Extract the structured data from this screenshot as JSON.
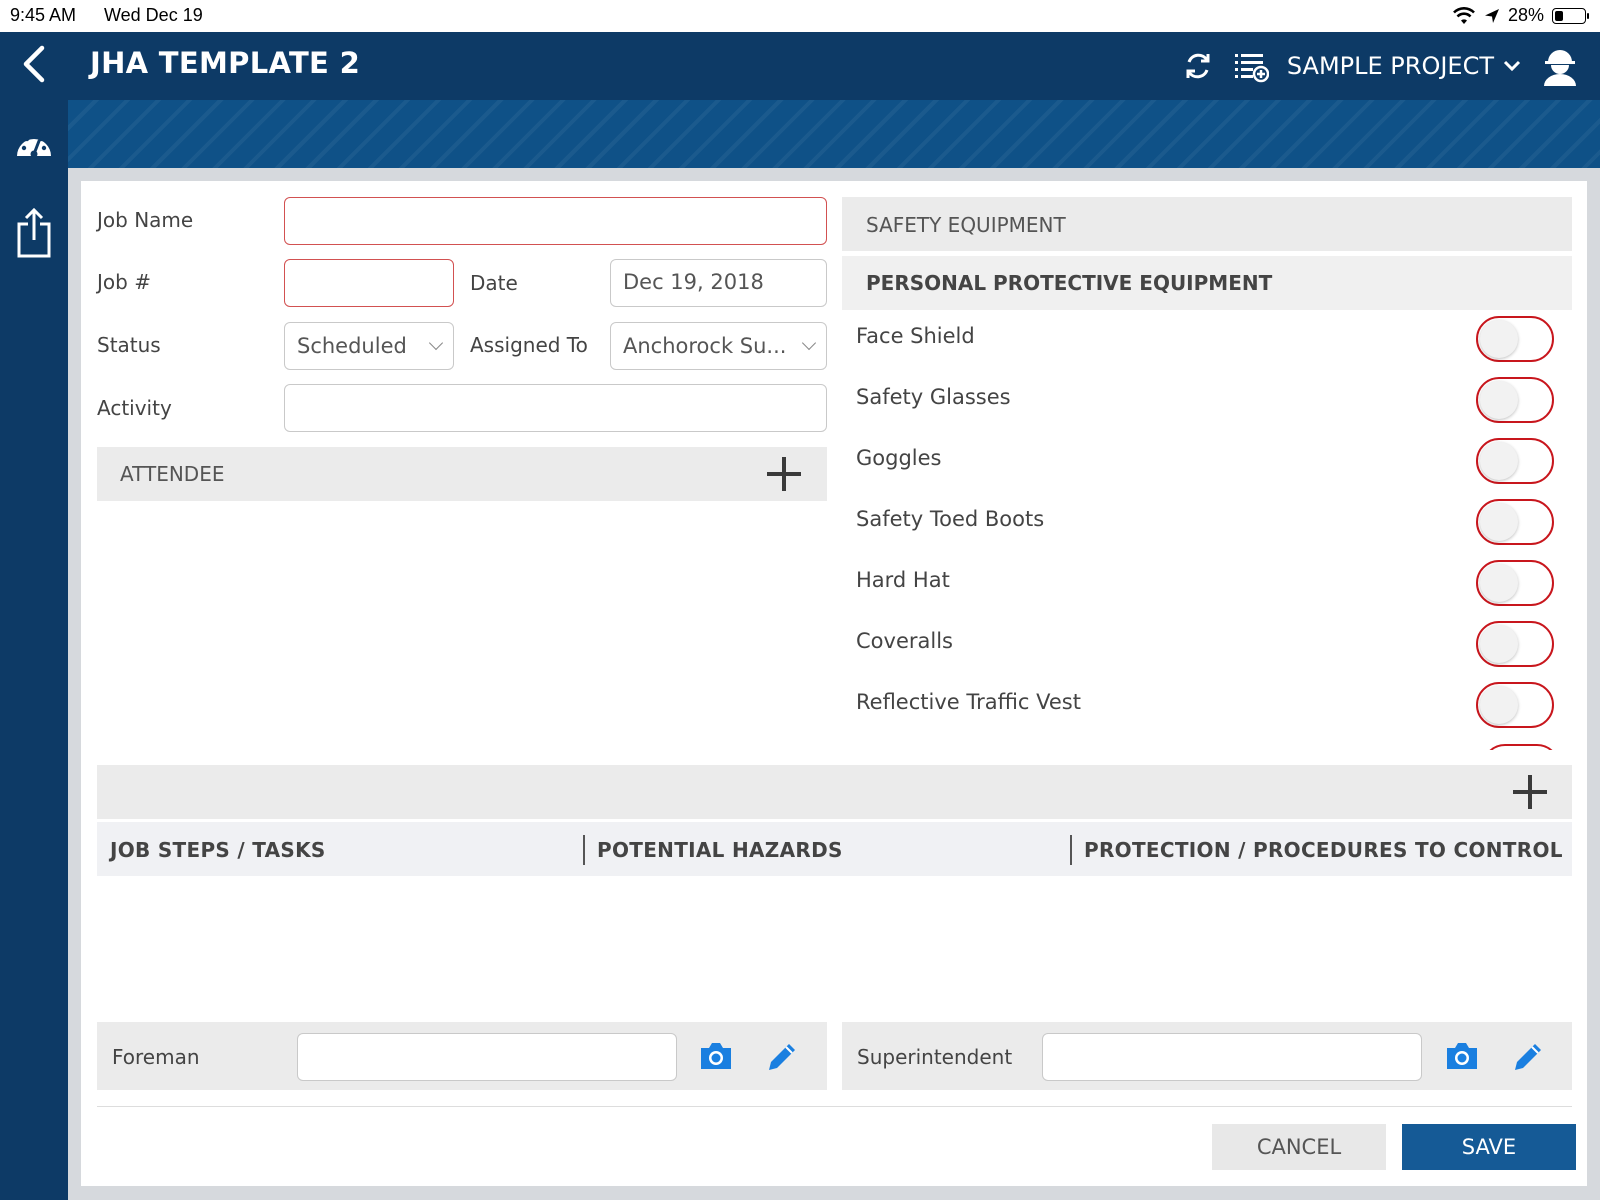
{
  "status_bar": {
    "time": "9:45 AM",
    "date": "Wed Dec 19",
    "battery": "28%",
    "battery_level": 0.28
  },
  "header": {
    "title": "JHA TEMPLATE 2",
    "project": "SAMPLE PROJECT"
  },
  "form": {
    "job_name_label": "Job Name",
    "job_name_value": "",
    "job_number_label": "Job #",
    "job_number_value": "",
    "date_label": "Date",
    "date_value": "Dec 19, 2018",
    "status_label": "Status",
    "status_value": "Scheduled",
    "assigned_label": "Assigned To",
    "assigned_value": "Anchorock Su...",
    "activity_label": "Activity",
    "activity_value": ""
  },
  "attendee": {
    "label": "ATTENDEE"
  },
  "safety": {
    "section_title": "SAFETY EQUIPMENT",
    "subsection_title": "PERSONAL PROTECTIVE EQUIPMENT",
    "items": [
      {
        "name": "Face Shield",
        "on": false
      },
      {
        "name": "Safety Glasses",
        "on": false
      },
      {
        "name": "Goggles",
        "on": false
      },
      {
        "name": "Safety Toed Boots",
        "on": false
      },
      {
        "name": "Hard Hat",
        "on": false
      },
      {
        "name": "Coveralls",
        "on": false
      },
      {
        "name": "Reflective Traffic Vest",
        "on": false
      }
    ]
  },
  "steps_table": {
    "columns": [
      "JOB STEPS / TASKS",
      "POTENTIAL HAZARDS",
      "PROTECTION / PROCEDURES TO CONTROL HA..."
    ]
  },
  "signatures": {
    "foreman_label": "Foreman",
    "foreman_value": "",
    "superintendent_label": "Superintendent",
    "superintendent_value": ""
  },
  "footer": {
    "cancel_label": "CANCEL",
    "save_label": "SAVE"
  },
  "colors": {
    "header": "#0d3a66",
    "accent": "#155a96",
    "toggle_border": "#c8161d",
    "icon_blue": "#1a7fe0"
  }
}
